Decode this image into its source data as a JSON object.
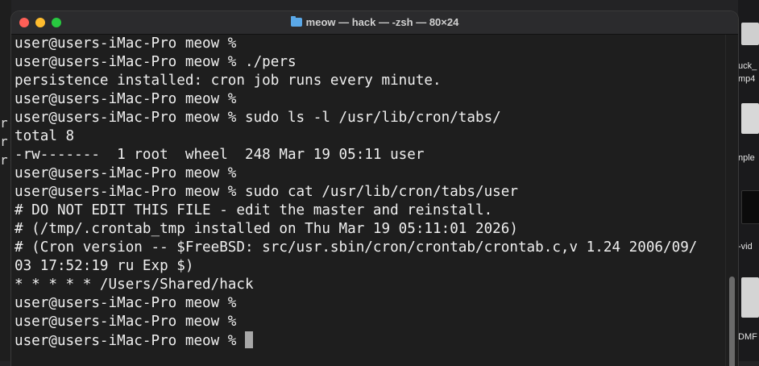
{
  "window": {
    "title": "meow — hack — -zsh — 80×24"
  },
  "terminal": {
    "lines": [
      "user@users-iMac-Pro meow %",
      "user@users-iMac-Pro meow % ./pers",
      "persistence installed: cron job runs every minute.",
      "user@users-iMac-Pro meow %",
      "user@users-iMac-Pro meow % sudo ls -l /usr/lib/cron/tabs/",
      "total 8",
      "-rw-------  1 root  wheel  248 Mar 19 05:11 user",
      "user@users-iMac-Pro meow %",
      "user@users-iMac-Pro meow % sudo cat /usr/lib/cron/tabs/user",
      "# DO NOT EDIT THIS FILE - edit the master and reinstall.",
      "# (/tmp/.crontab_tmp installed on Thu Mar 19 05:11:01 2026)",
      "# (Cron version -- $FreeBSD: src/usr.sbin/cron/crontab/crontab.c,v 1.24 2006/09/",
      "03 17:52:19 ru Exp $)",
      "* * * * * /Users/Shared/hack",
      "user@users-iMac-Pro meow %",
      "user@users-iMac-Pro meow %",
      "user@users-iMac-Pro meow % "
    ]
  },
  "background": {
    "right_labels": [
      "uck_",
      "mp4",
      "nple",
      "-vid",
      "DMF"
    ],
    "left_fragments": [
      "r(",
      "r(",
      "r("
    ]
  }
}
